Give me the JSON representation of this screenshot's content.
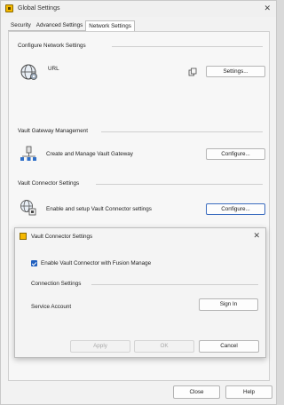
{
  "window": {
    "title": "Global Settings",
    "close_glyph": "✕"
  },
  "tabs": [
    {
      "label": "Security",
      "active": false
    },
    {
      "label": "Advanced Settings",
      "active": false
    },
    {
      "label": "Network Settings",
      "active": true
    }
  ],
  "network": {
    "section_title": "Configure Network Settings",
    "url_label": "URL",
    "url_copy_icon": "copy-icon",
    "settings_button": "Settings..."
  },
  "gateway": {
    "section_title": "Vault Gateway Management",
    "row_label": "Create and Manage Vault Gateway",
    "configure_button": "Configure..."
  },
  "connector": {
    "section_title": "Vault Connector Settings",
    "row_label": "Enable and setup Vault Connector settings",
    "configure_button": "Configure..."
  },
  "dialog": {
    "title": "Vault Connector Settings",
    "close_glyph": "✕",
    "enable_checkbox_label": "Enable Vault Connector with Fusion Manage",
    "enable_checked": true,
    "connection_section": "Connection Settings",
    "service_account_label": "Service Account",
    "sign_in_button": "Sign In",
    "apply_button": "Apply",
    "ok_button": "OK",
    "cancel_button": "Cancel"
  },
  "footer": {
    "close_button": "Close",
    "help_button": "Help"
  },
  "colors": {
    "accent": "#1f5fbf",
    "focus_border": "#3b6cbf",
    "app_icon": "#f5b800"
  }
}
